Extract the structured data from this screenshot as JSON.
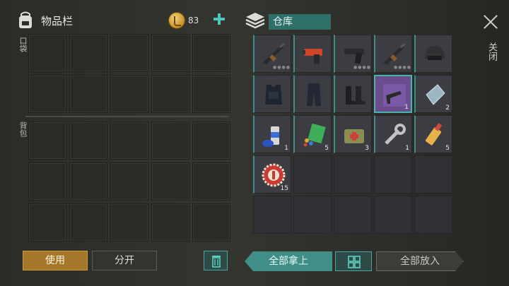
{
  "inventory": {
    "title": "物品栏",
    "pocket_label": "口袋",
    "backpack_label": "背包",
    "coins": "83"
  },
  "warehouse": {
    "title": "仓库",
    "close_label": "关闭",
    "items": [
      {
        "name": "shotgun-icon",
        "qty": "",
        "dots": true
      },
      {
        "name": "flare-gun-icon",
        "qty": "",
        "dots": false
      },
      {
        "name": "pistol-icon",
        "qty": "",
        "dots": true
      },
      {
        "name": "shotgun-icon",
        "qty": "",
        "dots": true
      },
      {
        "name": "helmet-icon",
        "qty": "",
        "dots": false
      },
      {
        "name": "body-armor-icon",
        "qty": "",
        "dots": false
      },
      {
        "name": "armored-pants-icon",
        "qty": "",
        "dots": false
      },
      {
        "name": "boots-icon",
        "qty": "",
        "dots": false
      },
      {
        "name": "smg-blueprint-icon",
        "qty": "1",
        "dots": false,
        "selected": true
      },
      {
        "name": "glass-sheet-icon",
        "qty": "2",
        "dots": false
      },
      {
        "name": "spray-can-icon",
        "qty": "1",
        "dots": false
      },
      {
        "name": "ammo-pack-icon",
        "qty": "5",
        "dots": false
      },
      {
        "name": "first-aid-kit-icon",
        "qty": "3",
        "dots": false
      },
      {
        "name": "wrench-icon",
        "qty": "1",
        "dots": false
      },
      {
        "name": "glue-tube-icon",
        "qty": "5",
        "dots": false
      },
      {
        "name": "bottle-cap-icon",
        "qty": "15",
        "dots": false
      }
    ]
  },
  "buttons": {
    "use": "使用",
    "split": "分开",
    "take_all": "全部拿上",
    "put_all": "全部放入"
  },
  "colors": {
    "accent": "#3f8f87",
    "use_button": "#a5772a",
    "selected_item": "#6b4d8e"
  }
}
